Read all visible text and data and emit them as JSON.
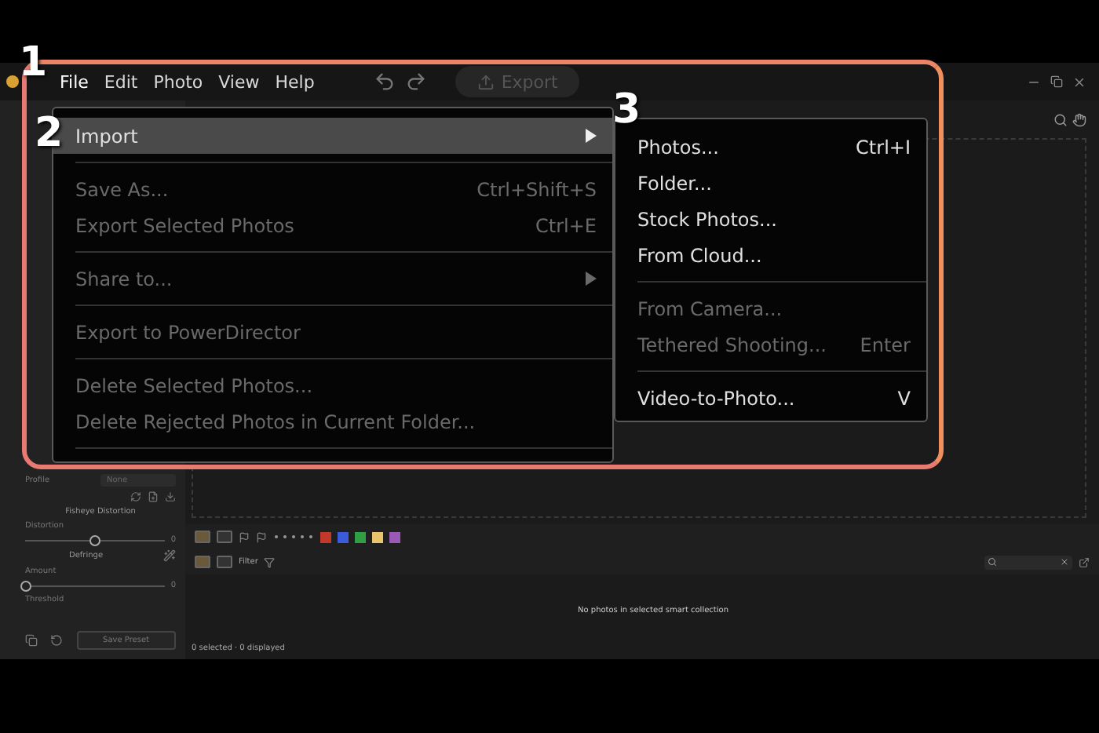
{
  "menubar": {
    "menus": [
      {
        "label": "File",
        "selected": true
      },
      {
        "label": "Edit",
        "selected": false
      },
      {
        "label": "Photo",
        "selected": false
      },
      {
        "label": "View",
        "selected": false
      },
      {
        "label": "Help",
        "selected": false
      }
    ],
    "export_button": {
      "label": "Export",
      "disabled": true
    }
  },
  "file_menu": {
    "items": [
      {
        "kind": "item",
        "label": "Import",
        "selected": true,
        "disabled": false,
        "submenu": true
      },
      {
        "kind": "separator"
      },
      {
        "kind": "item",
        "label": "Save As...",
        "shortcut": "Ctrl+Shift+S",
        "selected": false,
        "disabled": true,
        "submenu": false
      },
      {
        "kind": "item",
        "label": "Export Selected Photos",
        "shortcut": "Ctrl+E",
        "selected": false,
        "disabled": true,
        "submenu": false
      },
      {
        "kind": "separator"
      },
      {
        "kind": "item",
        "label": "Share to...",
        "selected": false,
        "disabled": true,
        "submenu": true
      },
      {
        "kind": "separator"
      },
      {
        "kind": "item",
        "label": "Export to PowerDirector",
        "selected": false,
        "disabled": true,
        "submenu": false
      },
      {
        "kind": "separator"
      },
      {
        "kind": "item",
        "label": "Delete Selected Photos...",
        "selected": false,
        "disabled": true,
        "submenu": false
      },
      {
        "kind": "item",
        "label": "Delete Rejected Photos in Current Folder...",
        "selected": false,
        "disabled": true,
        "submenu": false
      },
      {
        "kind": "separator"
      }
    ]
  },
  "import_submenu": {
    "items": [
      {
        "kind": "item",
        "label": "Photos...",
        "shortcut": "Ctrl+I",
        "disabled": false
      },
      {
        "kind": "item",
        "label": "Folder...",
        "disabled": false
      },
      {
        "kind": "item",
        "label": "Stock Photos...",
        "disabled": false
      },
      {
        "kind": "item",
        "label": "From Cloud...",
        "disabled": false
      },
      {
        "kind": "separator"
      },
      {
        "kind": "item",
        "label": "From Camera...",
        "disabled": true
      },
      {
        "kind": "item",
        "label": "Tethered Shooting...",
        "shortcut": "Enter",
        "disabled": true
      },
      {
        "kind": "separator"
      },
      {
        "kind": "item",
        "label": "Video-to-Photo...",
        "shortcut": "V",
        "disabled": false
      }
    ]
  },
  "annotations": [
    "1",
    "2",
    "3"
  ],
  "left_panel": {
    "profile_label": "Profile",
    "profile_value": "None",
    "section": "Fisheye Distortion",
    "sliders": [
      {
        "label": "Distortion",
        "level": 0.5,
        "value": "0"
      }
    ],
    "section_2": "Defringe",
    "sliders_2": [
      {
        "label": "Amount",
        "level": 0,
        "value": "0"
      }
    ],
    "threshold_label": "Threshold",
    "save_preset": "Save Preset"
  },
  "browser": {
    "filter_label": "Filter",
    "color_labels": [
      {
        "color": "#c0392b"
      },
      {
        "color": "#3b5bdb"
      },
      {
        "color": "#2f9e44"
      },
      {
        "color": "#e9c46a"
      },
      {
        "color": "#9b59b6"
      }
    ],
    "message": "No photos in selected smart collection",
    "status": "0 selected · 0 displayed"
  }
}
